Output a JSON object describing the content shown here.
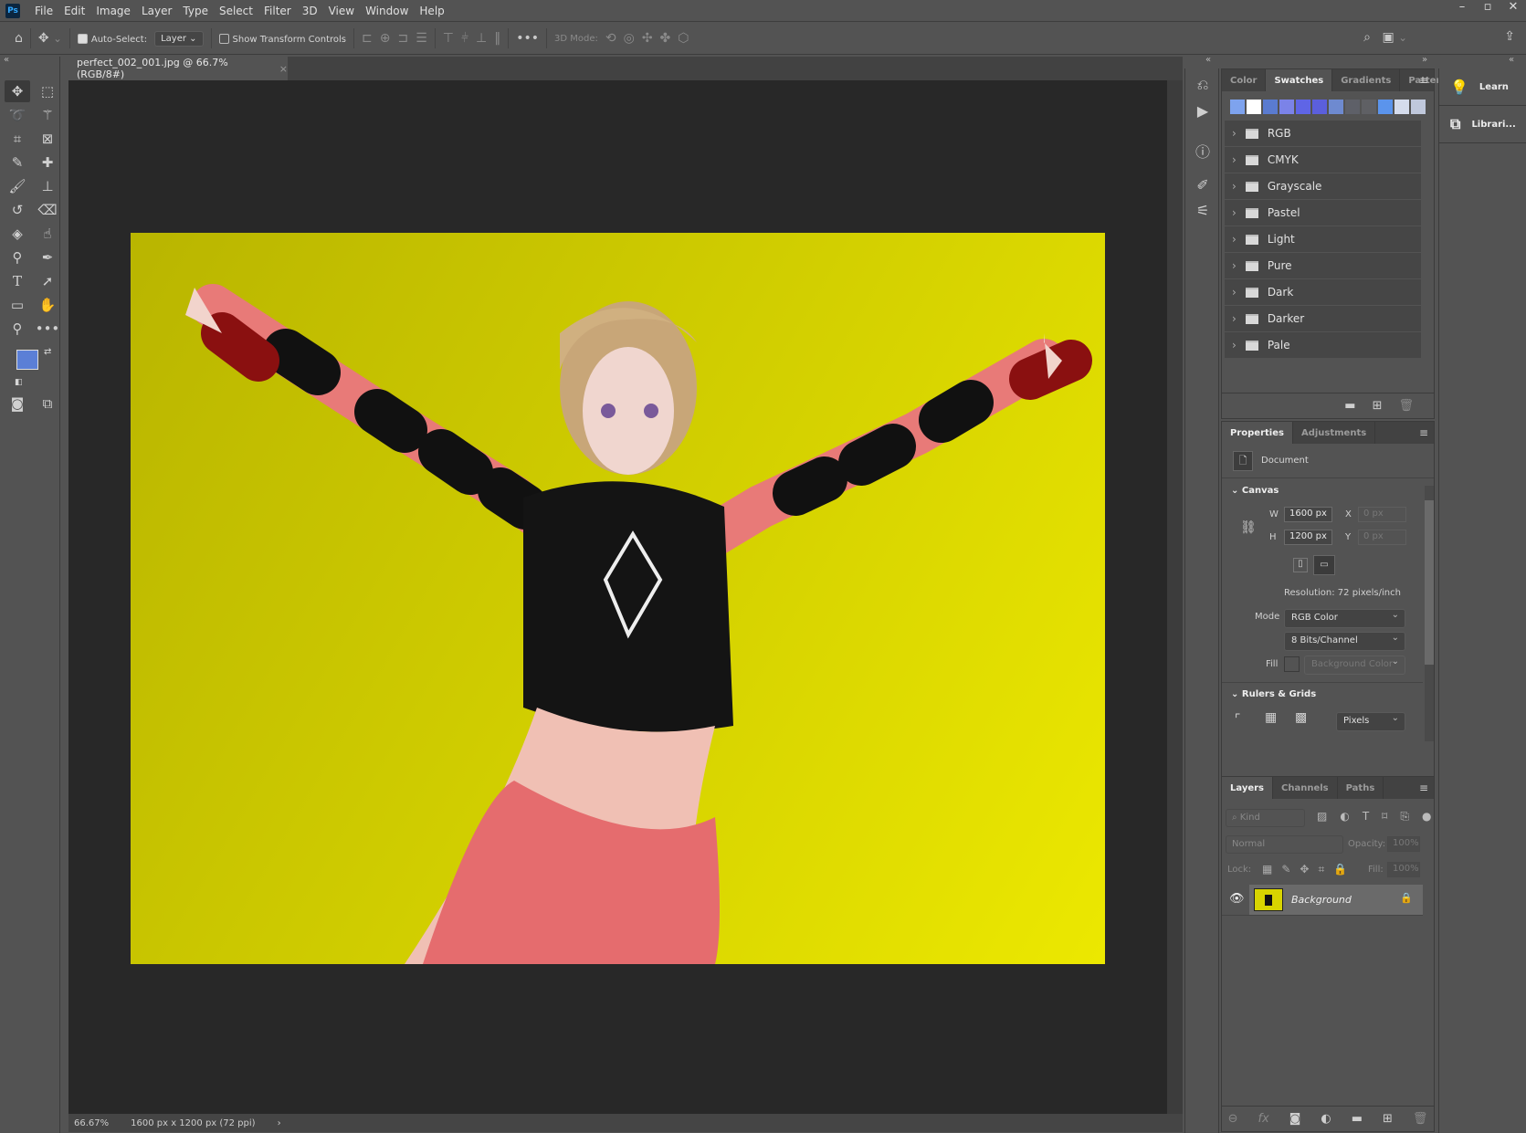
{
  "menu": {
    "app_icon": "Ps",
    "items": [
      "File",
      "Edit",
      "Image",
      "Layer",
      "Type",
      "Select",
      "Filter",
      "3D",
      "View",
      "Window",
      "Help"
    ]
  },
  "window_controls": {
    "minimize": "–",
    "restore": "▫",
    "close": "✕"
  },
  "options": {
    "auto_select_label": "Auto-Select:",
    "auto_select_checked": true,
    "auto_select_target": "Layer",
    "show_transform_label": "Show Transform Controls",
    "show_transform_checked": false,
    "more": "•••",
    "mode_3d_label": "3D Mode:"
  },
  "document": {
    "tab_title": "perfect_002_001.jpg @ 66.7% (RGB/8#)",
    "close": "×"
  },
  "status": {
    "zoom": "66.67%",
    "doc_info": "1600 px x 1200 px (72 ppi)",
    "arrow": "›"
  },
  "colors": {
    "foreground": "#5b7fd6",
    "background": "#8fb0f0"
  },
  "swatches_panel": {
    "tabs": [
      "Color",
      "Swatches",
      "Gradients",
      "Patterns"
    ],
    "active_tab": "Swatches",
    "recent": [
      "#7ea3ee",
      "#ffffff",
      "#5a7bd0",
      "#7b83e8",
      "#5f65e6",
      "#5b5fdc",
      "#6e8ad0",
      "#5e6068",
      "#5f6064",
      "#5b94ec",
      "#d5dcec",
      "#c0c8dc"
    ],
    "groups": [
      "RGB",
      "CMYK",
      "Grayscale",
      "Pastel",
      "Light",
      "Pure",
      "Dark",
      "Darker",
      "Pale"
    ]
  },
  "properties_panel": {
    "tabs": [
      "Properties",
      "Adjustments"
    ],
    "active_tab": "Properties",
    "type_label": "Document",
    "canvas_section": "Canvas",
    "w_label": "W",
    "w_value": "1600 px",
    "h_label": "H",
    "h_value": "1200 px",
    "x_label": "X",
    "x_value": "0 px",
    "y_label": "Y",
    "y_value": "0 px",
    "resolution": "Resolution: 72 pixels/inch",
    "mode_label": "Mode",
    "mode_value": "RGB Color",
    "depth_value": "8 Bits/Channel",
    "fill_label": "Fill",
    "fill_value": "Background Color",
    "rulers_section": "Rulers & Grids",
    "units_value": "Pixels"
  },
  "layers_panel": {
    "tabs": [
      "Layers",
      "Channels",
      "Paths"
    ],
    "active_tab": "Layers",
    "kind_placeholder": "Kind",
    "blend_mode": "Normal",
    "opacity_label": "Opacity:",
    "opacity_value": "100%",
    "lock_label": "Lock:",
    "fill_label": "Fill:",
    "fill_value": "100%",
    "layers": [
      {
        "name": "Background",
        "visible": true,
        "locked": true
      }
    ]
  },
  "right_panels": [
    {
      "label": "Learn"
    },
    {
      "label": "Librari..."
    }
  ]
}
